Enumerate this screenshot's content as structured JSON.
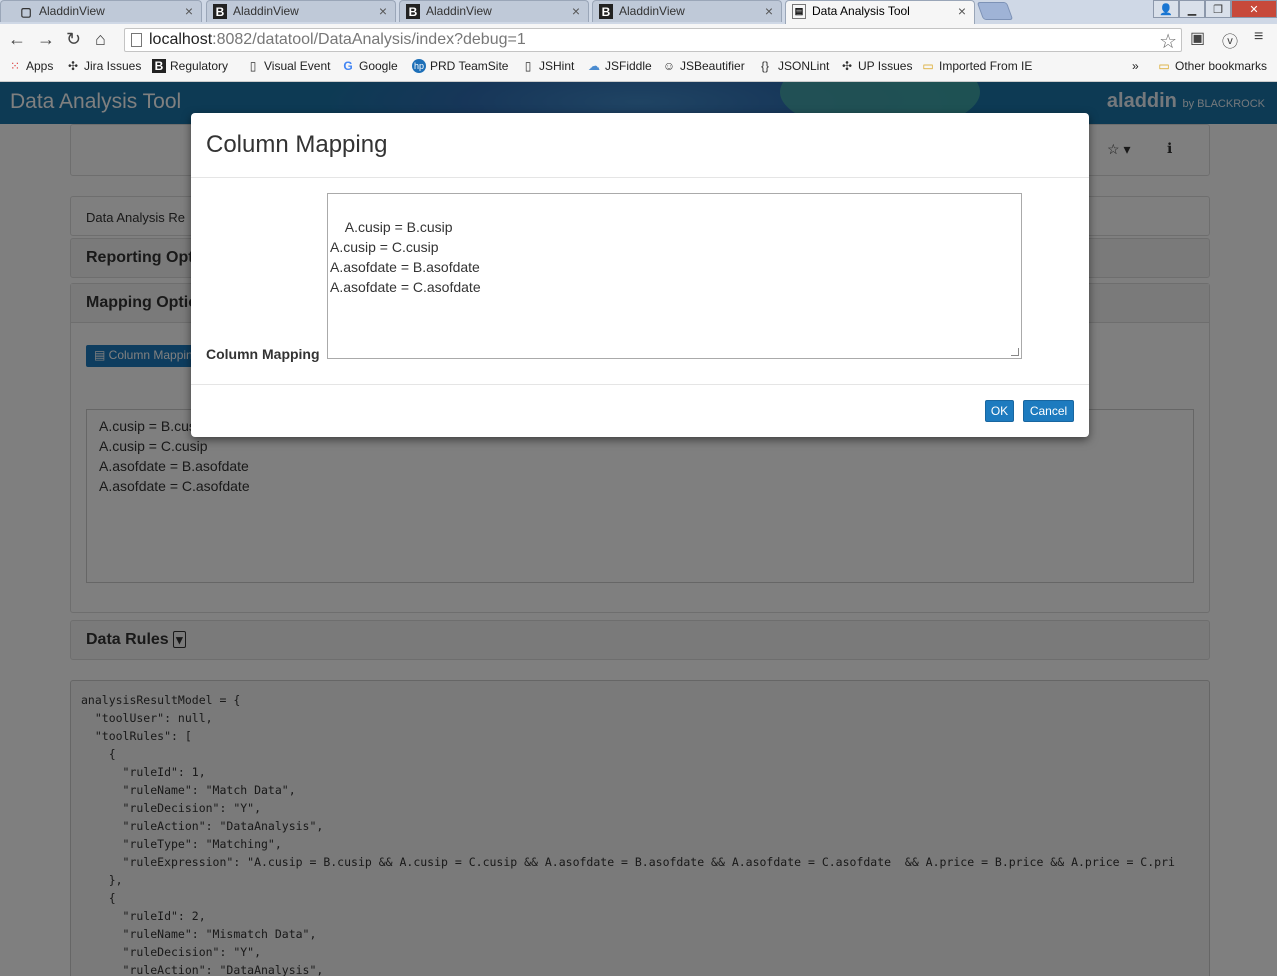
{
  "browser": {
    "tabs": [
      {
        "label": "AladdinView"
      },
      {
        "label": "AladdinView"
      },
      {
        "label": "AladdinView"
      },
      {
        "label": "AladdinView"
      },
      {
        "label": "Data Analysis Tool"
      }
    ],
    "url_host": "localhost",
    "url_rest": ":8082/datatool/DataAnalysis/index?debug=1",
    "bookmarks": [
      {
        "label": "Apps"
      },
      {
        "label": "Jira Issues"
      },
      {
        "label": "Regulatory"
      },
      {
        "label": "Visual Event"
      },
      {
        "label": "Google"
      },
      {
        "label": "PRD TeamSite"
      },
      {
        "label": "JSHint"
      },
      {
        "label": "JSFiddle"
      },
      {
        "label": "JSBeautifier"
      },
      {
        "label": "JSONLint"
      },
      {
        "label": "UP Issues"
      },
      {
        "label": "Imported From IE"
      }
    ],
    "more_bookmarks": "»",
    "other_bookmarks": "Other bookmarks"
  },
  "app": {
    "title": "Data Analysis Tool",
    "brand": "aladdin",
    "brand_suffix": "by BLACKROCK"
  },
  "page": {
    "results_label": "Data Analysis Re",
    "reporting_options": "Reporting Opt",
    "mapping_options": "Mapping Optio",
    "column_mapping_button": "Column Mappin",
    "mapping_text": "A.cusip = B.cusip\nA.cusip = C.cusip\nA.asofdate = B.asofdate\nA.asofdate = C.asofdate",
    "data_rules": "Data Rules",
    "code": "analysisResultModel = {\n  \"toolUser\": null,\n  \"toolRules\": [\n    {\n      \"ruleId\": 1,\n      \"ruleName\": \"Match Data\",\n      \"ruleDecision\": \"Y\",\n      \"ruleAction\": \"DataAnalysis\",\n      \"ruleType\": \"Matching\",\n      \"ruleExpression\": \"A.cusip = B.cusip && A.cusip = C.cusip && A.asofdate = B.asofdate && A.asofdate = C.asofdate  && A.price = B.price && A.price = C.pri\n    },\n    {\n      \"ruleId\": 2,\n      \"ruleName\": \"Mismatch Data\",\n      \"ruleDecision\": \"Y\",\n      \"ruleAction\": \"DataAnalysis\","
  },
  "modal": {
    "title": "Column Mapping",
    "field_label": "Column Mapping",
    "field_value": "A.cusip = B.cusip\nA.cusip = C.cusip\nA.asofdate = B.asofdate\nA.asofdate = C.asofdate",
    "ok_label": "OK",
    "cancel_label": "Cancel"
  }
}
